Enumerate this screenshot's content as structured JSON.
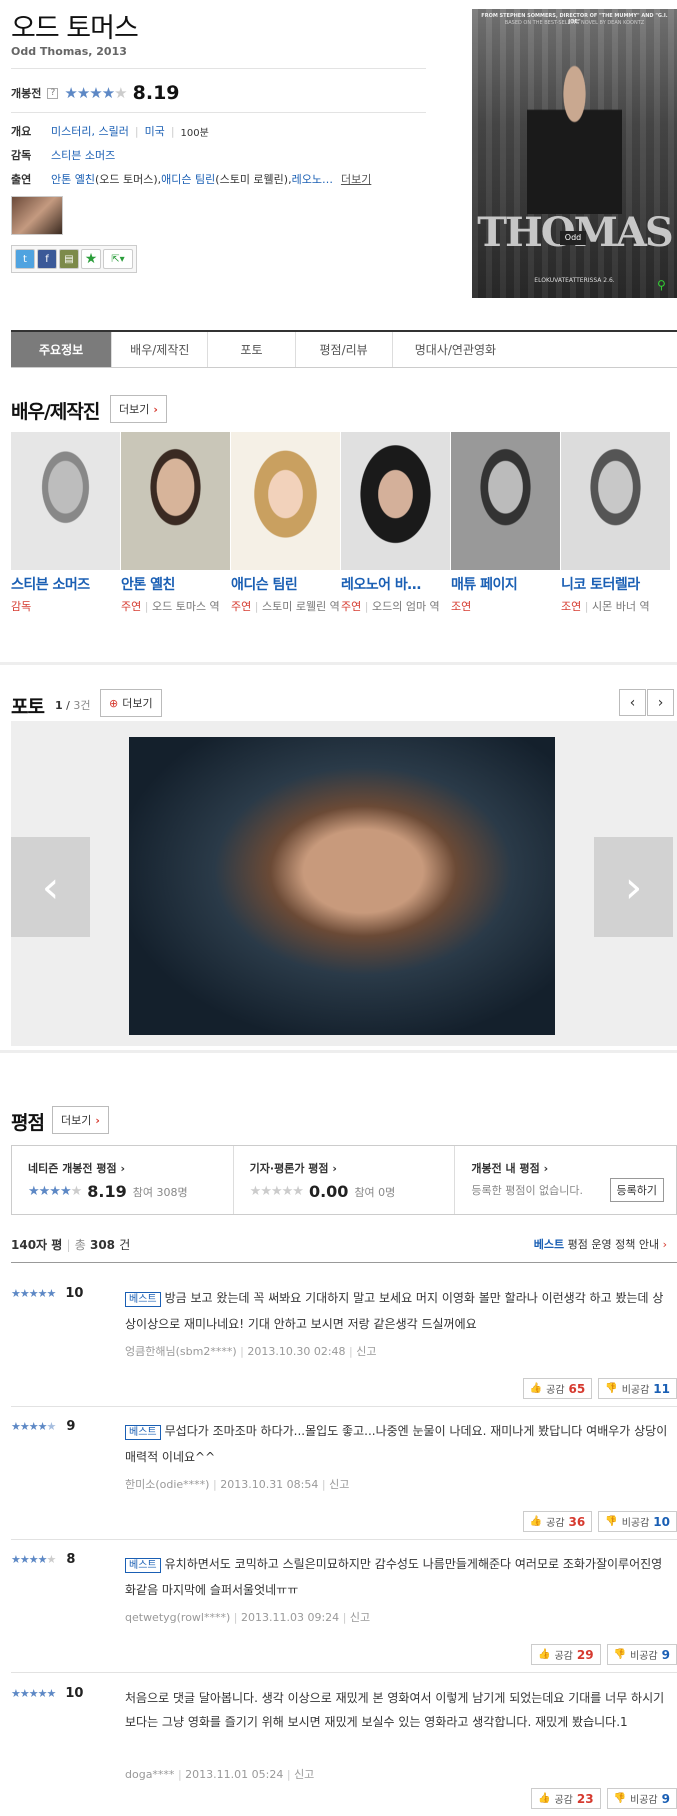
{
  "movie": {
    "title": "오드 토머스",
    "subtitle": "Odd Thomas, 2013",
    "rating_label": "개봉전",
    "rating_score": "8.19",
    "rating_stars": 4,
    "overview_label": "개요",
    "genre": "미스터리, 스릴러",
    "country": "미국",
    "runtime": "100분",
    "director_label": "감독",
    "director": "스티븐 소머즈",
    "cast_label": "출연",
    "cast_1": "안톤 옐친",
    "cast_1_role": "(오드 토머스), ",
    "cast_2": "애디슨 팀린",
    "cast_2_role": "(스토미 로웰린), ",
    "cast_3": "레오노…",
    "more": "더보기"
  },
  "poster": {
    "top_text": "FROM STEPHEN SOMMERS, DIRECTOR OF \"THE MUMMY\" AND \"G.I. JOE\"",
    "top_text2": "BASED ON THE BEST-SELLING NOVEL BY DEAN KOONTZ",
    "odd": "Odd",
    "thomas": "THOMAS",
    "bottom": "ELOKUVATEATTERISSA 2.6."
  },
  "tabs": [
    "주요정보",
    "배우/제작진",
    "포토",
    "평점/리뷰",
    "명대사/연관영화"
  ],
  "cast_section": {
    "title": "배우/제작진",
    "more": "더보기",
    "people": [
      {
        "name": "스티븐 소머즈",
        "role": "감독",
        "part": ""
      },
      {
        "name": "안톤 옐친",
        "role": "주연",
        "part": "오드 토마스 역"
      },
      {
        "name": "애디슨 팀린",
        "role": "주연",
        "part": "스토미 로웰린 역"
      },
      {
        "name": "레오노어 바…",
        "role": "주연",
        "part": "오드의 엄마 역"
      },
      {
        "name": "매튜 페이지",
        "role": "조연",
        "part": ""
      },
      {
        "name": "니코 토터렐라",
        "role": "조연",
        "part": "시몬 바너 역"
      }
    ]
  },
  "photo_section": {
    "title": "포토",
    "current": "1",
    "total": "3건",
    "more": "더보기"
  },
  "rating_section": {
    "title": "평점",
    "more": "더보기",
    "netizen_label": "네티즌 개봉전 평점",
    "netizen_score": "8.19",
    "netizen_count": "참여 308명",
    "critic_label": "기자·평론가 평점",
    "critic_score": "0.00",
    "critic_count": "참여 0명",
    "my_label": "개봉전 내 평점",
    "my_text": "등록한 평점이 없습니다.",
    "register": "등록하기",
    "list_label": "140자 평",
    "total_prefix": "총",
    "total": "308",
    "total_suffix": "건",
    "best": "베스트",
    "policy": "평점 운영 정책 안내"
  },
  "reviews": [
    {
      "score": "10",
      "stars": 5,
      "best": "베스트",
      "text": "방금 보고 왔는데 꼭 써봐요 기대하지 말고 보세요 머지 이영화 볼만 할라나 이런생각 하고 봤는데 상상이상으로 재미나네요! 기대 안하고 보시면 저랑 같은생각 드실꺼에요",
      "user": "엉큼한해님(sbm2****)",
      "date": "2013.10.30 02:48",
      "report": "신고",
      "like": "65",
      "dislike": "11"
    },
    {
      "score": "9",
      "stars": 4.5,
      "best": "베스트",
      "text": "무섭다가 조마조마 하다가...몰입도 좋고...나중엔 눈물이 나데요. 재미나게 봤답니다 여배우가 상당이 매력적 이네요^^",
      "user": "한미소(odie****)",
      "date": "2013.10.31 08:54",
      "report": "신고",
      "like": "36",
      "dislike": "10"
    },
    {
      "score": "8",
      "stars": 4,
      "best": "베스트",
      "text": "유치하면서도 코믹하고 스릴은미묘하지만 감수성도 나름만들게해준다 여러모로 조화가잘이루어진영화같음 마지막에 슬퍼서울엇네ㅠㅠ",
      "user": "qetwetyg(rowl****)",
      "date": "2013.11.03 09:24",
      "report": "신고",
      "like": "29",
      "dislike": "9"
    },
    {
      "score": "10",
      "stars": 5,
      "best": "",
      "text": "처음으로 댓글 달아봅니다. 생각 이상으로 재밌게 본 영화여서 이렇게 남기게 되었는데요 기대를 너무 하시기 보다는 그냥 영화를 즐기기 위해 보시면 재밌게 보실수 있는 영화라고 생각합니다. 재밌게 봤습니다.1",
      "user": "doga****",
      "date": "2013.11.01 05:24",
      "report": "신고",
      "like": "23",
      "dislike": "9"
    }
  ],
  "labels": {
    "like": "공감",
    "dislike": "비공감"
  }
}
